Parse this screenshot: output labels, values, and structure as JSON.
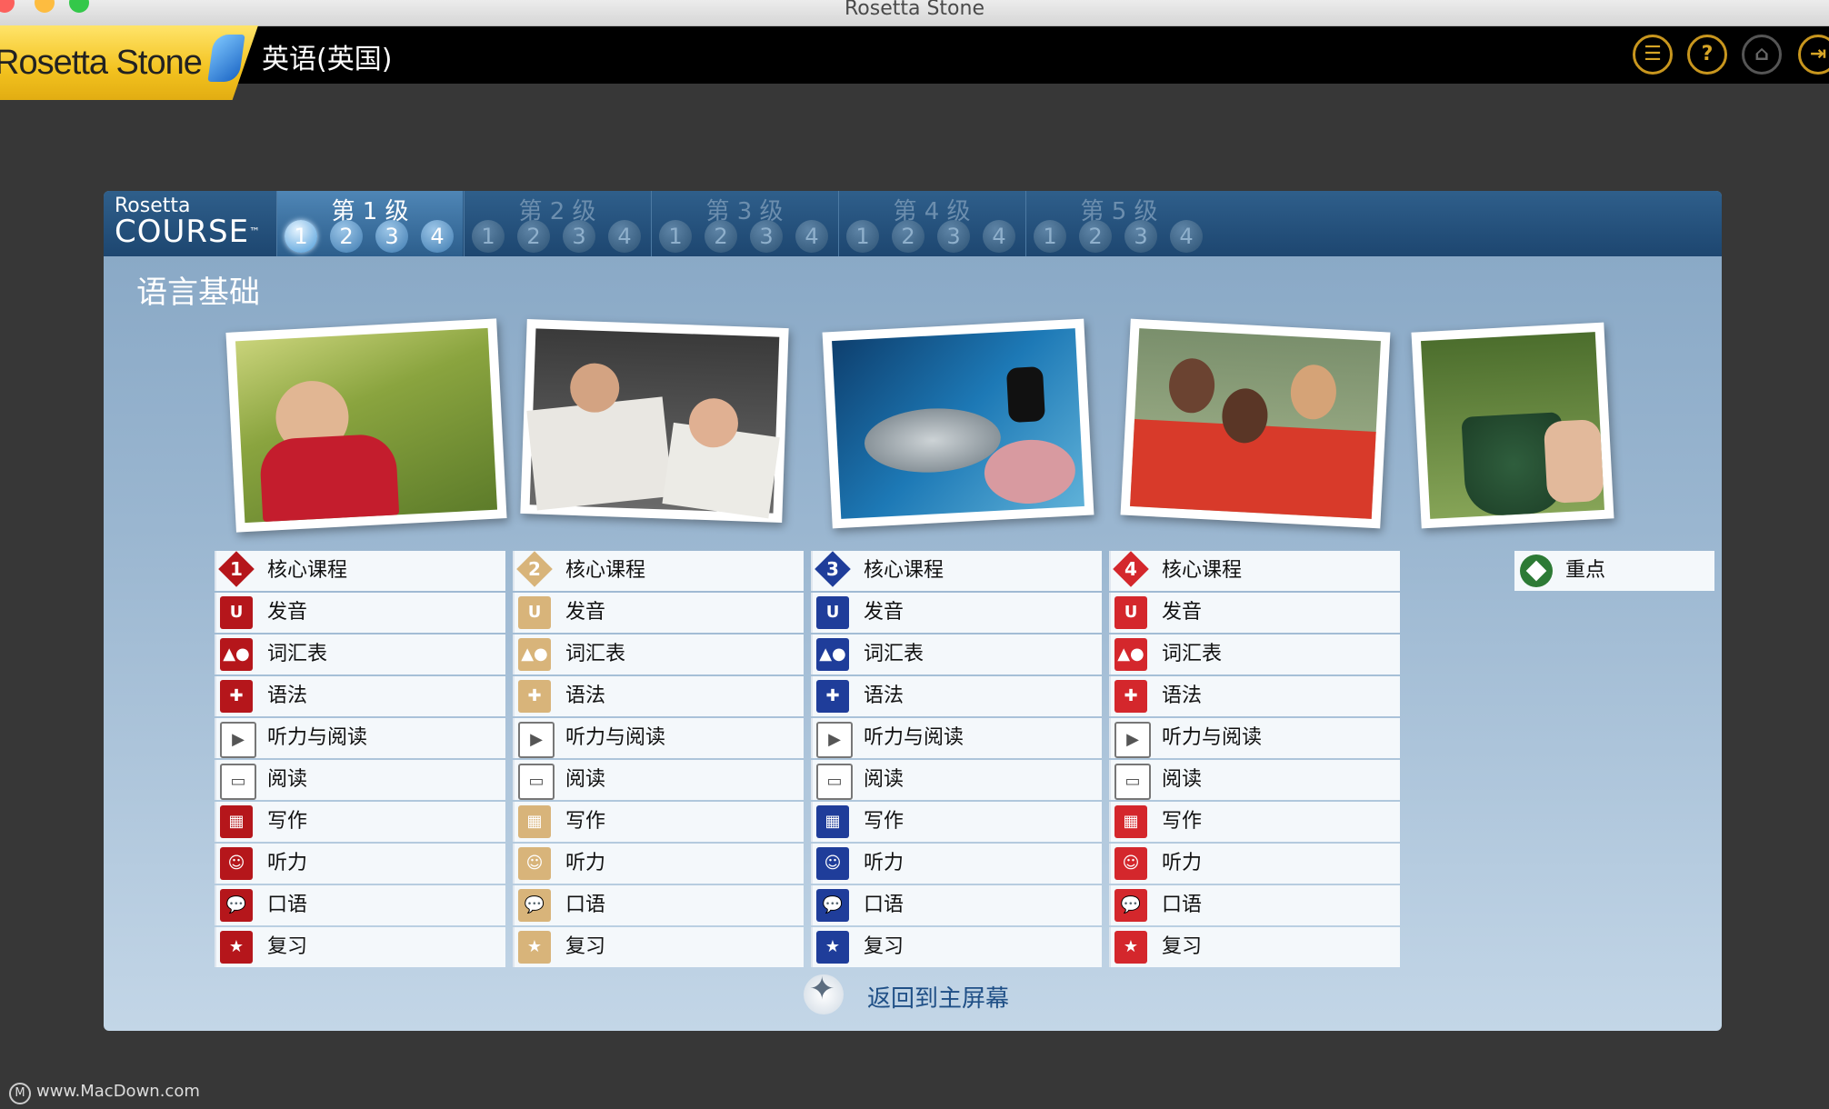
{
  "window": {
    "title": "Rosetta Stone"
  },
  "header": {
    "brand_regular": "osetta",
    "brand_r": "R",
    "brand_stone": "Stone",
    "course_language": "英语(英国)",
    "controls": [
      {
        "name": "menu-icon",
        "glyph": "☰"
      },
      {
        "name": "help-icon",
        "glyph": "?"
      },
      {
        "name": "home-icon",
        "glyph": "⌂"
      },
      {
        "name": "exit-icon",
        "glyph": "⇥"
      }
    ]
  },
  "course_nav": {
    "logo_top": "Rosetta",
    "logo_bottom": "COURSE",
    "logo_tm": "™",
    "levels": [
      {
        "title": "第 1 级",
        "units": [
          "1",
          "2",
          "3",
          "4"
        ],
        "active": true,
        "selected_unit": "1"
      },
      {
        "title": "第 2 级",
        "units": [
          "1",
          "2",
          "3",
          "4"
        ],
        "active": false
      },
      {
        "title": "第 3 级",
        "units": [
          "1",
          "2",
          "3",
          "4"
        ],
        "active": false
      },
      {
        "title": "第 4 级",
        "units": [
          "1",
          "2",
          "3",
          "4"
        ],
        "active": false
      },
      {
        "title": "第 5 级",
        "units": [
          "1",
          "2",
          "3",
          "4"
        ],
        "active": false
      }
    ]
  },
  "unit_title": "语言基础",
  "lesson_colors": {
    "1": "#b5161b",
    "2": "#d8b47a",
    "3": "#1f3d9a",
    "4": "#d4272c"
  },
  "lessons": [
    {
      "number": "1",
      "items": [
        "核心课程",
        "发音",
        "词汇表",
        "语法",
        "听力与阅读",
        "阅读",
        "写作",
        "听力",
        "口语",
        "复习"
      ]
    },
    {
      "number": "2",
      "items": [
        "核心课程",
        "发音",
        "词汇表",
        "语法",
        "听力与阅读",
        "阅读",
        "写作",
        "听力",
        "口语",
        "复习"
      ]
    },
    {
      "number": "3",
      "items": [
        "核心课程",
        "发音",
        "词汇表",
        "语法",
        "听力与阅读",
        "阅读",
        "写作",
        "听力",
        "口语",
        "复习"
      ]
    },
    {
      "number": "4",
      "items": [
        "核心课程",
        "发音",
        "词汇表",
        "语法",
        "听力与阅读",
        "阅读",
        "写作",
        "听力",
        "口语",
        "复习"
      ]
    }
  ],
  "focus": {
    "label": "重点"
  },
  "back_link": "返回到主屏幕",
  "watermark": "www.MacDown.com"
}
